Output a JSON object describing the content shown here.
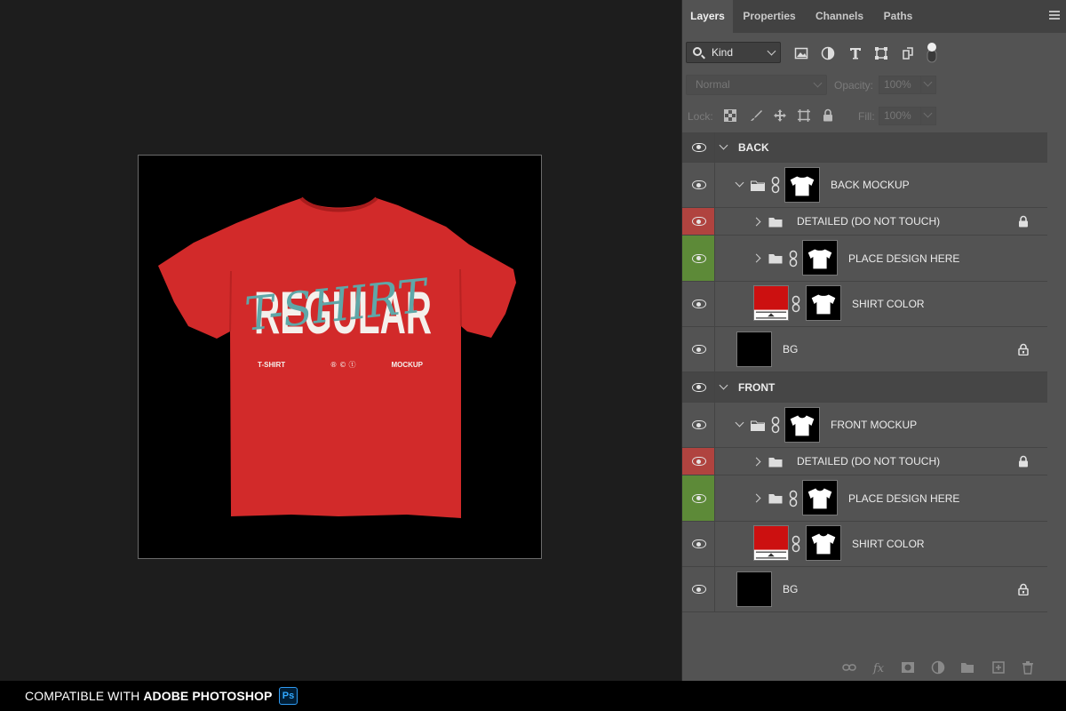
{
  "tabs": [
    {
      "label": "Layers",
      "active": true
    },
    {
      "label": "Properties",
      "active": false
    },
    {
      "label": "Channels",
      "active": false
    },
    {
      "label": "Paths",
      "active": false
    }
  ],
  "filter": {
    "kind_label": "Kind"
  },
  "blend": {
    "mode": "Normal",
    "opacity_label": "Opacity:",
    "opacity_value": "100%"
  },
  "lock_row": {
    "lock_label": "Lock:",
    "fill_label": "Fill:",
    "fill_value": "100%"
  },
  "groups": {
    "back": {
      "label": "BACK"
    },
    "front": {
      "label": "FRONT"
    }
  },
  "layers": {
    "back_mockup": "BACK MOCKUP",
    "back_detailed": "DETAILED (DO NOT TOUCH)",
    "back_place": "PLACE DESIGN HERE",
    "back_color": "SHIRT COLOR",
    "back_bg": "BG",
    "front_mockup": "FRONT MOCKUP",
    "front_detailed": "DETAILED  (DO NOT TOUCH)",
    "front_place": "PLACE DESIGN HERE",
    "front_color": "SHIRT COLOR",
    "front_bg": "BG"
  },
  "mockup": {
    "big_word": "REGULAR",
    "script_word": "T-SHIRT",
    "left_small": "T-SHIRT",
    "right_small": "MOCKUP",
    "symbols": "® © ⓣ",
    "shirt_color": "#d22a2a",
    "script_color": "#5fa7a8"
  },
  "caption": {
    "prefix": "COMPATIBLE WITH ",
    "bold": "ADOBE PHOTOSHOP",
    "badge": "Ps"
  },
  "colors": {
    "locked_row_flag": "#b0433f",
    "design_row_flag": "#5d8a38",
    "swatch_red": "#cc1010"
  }
}
